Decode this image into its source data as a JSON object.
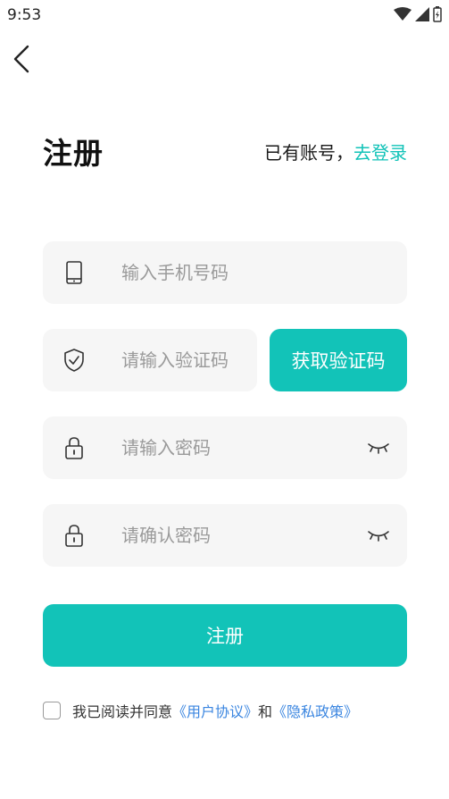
{
  "status_bar": {
    "time": "9:53"
  },
  "header": {
    "title": "注册",
    "login_prompt": "已有账号，",
    "login_link": "去登录"
  },
  "form": {
    "phone_placeholder": "输入手机号码",
    "code_placeholder": "请输入验证码",
    "get_code_label": "获取验证码",
    "password_placeholder": "请输入密码",
    "confirm_placeholder": "请确认密码",
    "submit_label": "注册"
  },
  "agreement": {
    "prefix": "我已阅读并同意",
    "user_agreement": "《用户协议》",
    "conjunction": "和",
    "privacy_policy": "《隐私政策》",
    "checked": false
  },
  "colors": {
    "accent": "#12c3b8",
    "link_blue": "#3b86e0",
    "field_bg": "#f6f6f6"
  },
  "icons": [
    "back-arrow-icon",
    "wifi-icon",
    "signal-icon",
    "battery-icon",
    "phone-icon",
    "shield-check-icon",
    "lock-icon",
    "eye-closed-icon"
  ]
}
